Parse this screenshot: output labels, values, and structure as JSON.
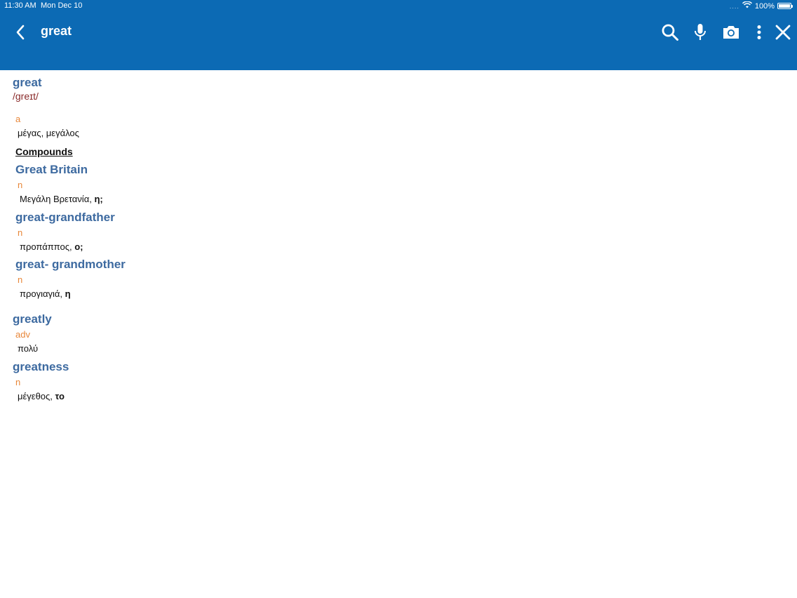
{
  "status_bar": {
    "time": "11:30 AM",
    "date": "Mon Dec 10",
    "signal": "....",
    "battery": "100%"
  },
  "header": {
    "query": "great",
    "icons": {
      "back": "chevron-left-icon",
      "search": "search-icon",
      "mic": "microphone-icon",
      "camera": "camera-icon",
      "more": "more-vertical-icon",
      "close": "close-icon"
    },
    "color": "#0c6ab4"
  },
  "entry": {
    "headword": "great",
    "pronunciation": "/greɪt/",
    "pos": "a",
    "translation": "μέγας, μεγάλος",
    "compounds_heading": "Compounds",
    "compounds": [
      {
        "headword": "Great Britain",
        "pos": "n",
        "translation": "Μεγάλη Βρετανία,",
        "gender": "η;"
      },
      {
        "headword": "great-grandfather",
        "pos": "n",
        "translation": "προπάππος,",
        "gender": "ο;"
      },
      {
        "headword": "great- grandmother",
        "pos": "n",
        "translation": "προγιαγιά,",
        "gender": "η"
      }
    ]
  },
  "related": [
    {
      "headword": "greatly",
      "pos": "adv",
      "translation": "πολύ",
      "gender": ""
    },
    {
      "headword": "greatness",
      "pos": "n",
      "translation": "μέγεθος,",
      "gender": "το"
    }
  ],
  "colors": {
    "headword": "#3d6aa0",
    "pos": "#e8873a",
    "pronunciation": "#8a2b2b"
  }
}
